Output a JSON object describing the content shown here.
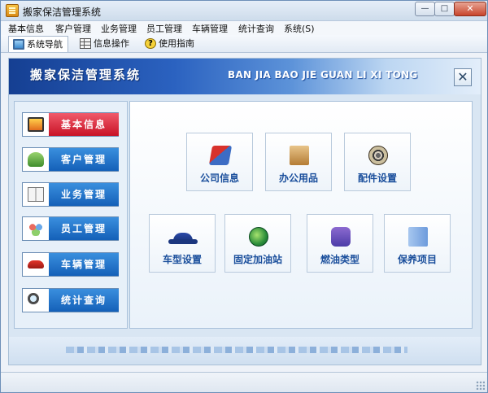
{
  "window": {
    "title": "搬家保洁管理系统",
    "buttons": {
      "minimize": "—",
      "maximize": "□",
      "close": "✕"
    }
  },
  "menu": [
    "基本信息",
    "客户管理",
    "业务管理",
    "员工管理",
    "车辆管理",
    "统计查询",
    "系统(S)"
  ],
  "tabs": [
    {
      "label": "系统导航",
      "icon": "monitor-icon",
      "active": true
    },
    {
      "label": "信息操作",
      "icon": "grid-icon",
      "active": false
    },
    {
      "label": "使用指南",
      "icon": "help-icon",
      "active": false
    }
  ],
  "banner": {
    "title": "搬家保洁管理系统",
    "pinyin": "BAN JIA BAO JIE GUAN LI XI TONG",
    "close_glyph": "✕"
  },
  "nav": [
    {
      "label": "基本信息",
      "icon": "monitor-icon",
      "active": true
    },
    {
      "label": "客户管理",
      "icon": "user-icon",
      "active": false
    },
    {
      "label": "业务管理",
      "icon": "book-icon",
      "active": false
    },
    {
      "label": "员工管理",
      "icon": "people-icon",
      "active": false
    },
    {
      "label": "车辆管理",
      "icon": "car-icon",
      "active": false
    },
    {
      "label": "统计查询",
      "icon": "search-icon",
      "active": false
    }
  ],
  "tiles": [
    {
      "label": "公司信息",
      "icon": "folder-icon"
    },
    {
      "label": "办公用品",
      "icon": "office-supplies-icon"
    },
    {
      "label": "配件设置",
      "icon": "film-reel-icon"
    },
    {
      "label": "车型设置",
      "icon": "car-icon"
    },
    {
      "label": "固定加油站",
      "icon": "globe-icon"
    },
    {
      "label": "燃油类型",
      "icon": "fuel-icon"
    },
    {
      "label": "保养项目",
      "icon": "box-icon"
    }
  ],
  "colors": {
    "banner_dark": "#153f92",
    "nav_blue": "#1460b8",
    "nav_active_red": "#c81226",
    "tile_text": "#1b4f9c"
  }
}
